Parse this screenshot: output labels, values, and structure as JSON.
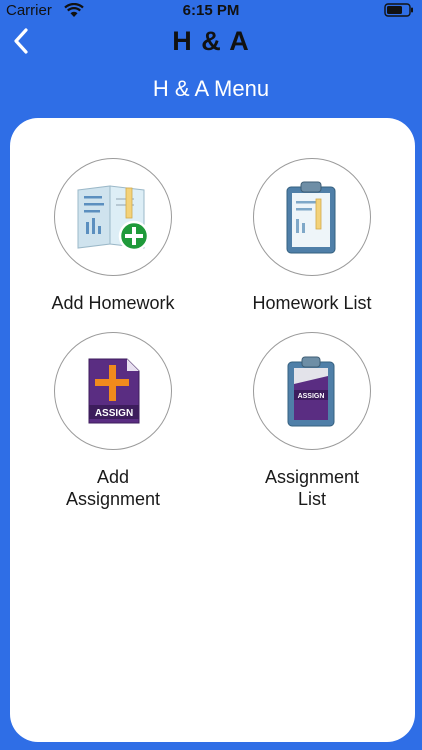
{
  "status_bar": {
    "carrier": "Carrier",
    "time": "6:15 PM"
  },
  "nav": {
    "title": "H & A",
    "back_icon": "chevron-left-icon"
  },
  "menu_title": "H & A Menu",
  "tiles": [
    {
      "label": "Add Homework",
      "icon": "add-homework-icon"
    },
    {
      "label": "Homework List",
      "icon": "homework-list-icon"
    },
    {
      "label": "Add\nAssignment",
      "icon": "add-assignment-icon",
      "badge": "ASSIGN"
    },
    {
      "label": "Assignment\nList",
      "icon": "assignment-list-icon",
      "badge": "ASSIGN"
    }
  ],
  "colors": {
    "background": "#2f6ee6",
    "card": "#ffffff",
    "plus_green": "#1f9a3a",
    "plus_orange": "#f08a1c",
    "assign_purple": "#5a2d82"
  }
}
